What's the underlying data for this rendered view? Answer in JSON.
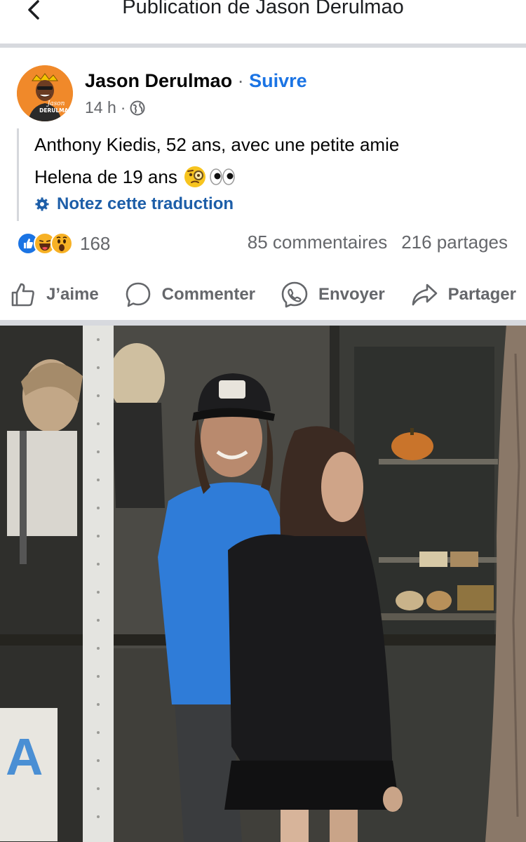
{
  "topbar": {
    "title": "Publication de Jason Derulmao"
  },
  "post": {
    "author": "Jason Derulmao",
    "separator": "·",
    "follow_label": "Suivre",
    "time": "14 h",
    "meta_dot": "·",
    "avatar_text": [
      "Jason",
      "DERULMAO"
    ],
    "text_line1": "Anthony Kiedis, 52 ans, avec une petite amie",
    "text_line2": "Helena de 19 ans",
    "translate_label": "Notez cette traduction"
  },
  "stats": {
    "reaction_count": "168",
    "comments": "85 commentaires",
    "shares": "216 partages"
  },
  "actions": {
    "like": "J’aime",
    "comment": "Commenter",
    "send": "Envoyer",
    "share": "Partager"
  },
  "icons": [
    "back-icon",
    "globe-icon",
    "monocle-emoji-icon",
    "eyes-emoji-icon",
    "settings-icon",
    "like-reaction-icon",
    "haha-reaction-icon",
    "wow-reaction-icon",
    "thumbs-up-icon",
    "comment-icon",
    "messenger-icon",
    "share-icon"
  ],
  "colors": {
    "link_blue": "#1b74e4",
    "translate_blue": "#1d5ea8",
    "muted": "#65676b",
    "separator": "#d7d9de"
  }
}
